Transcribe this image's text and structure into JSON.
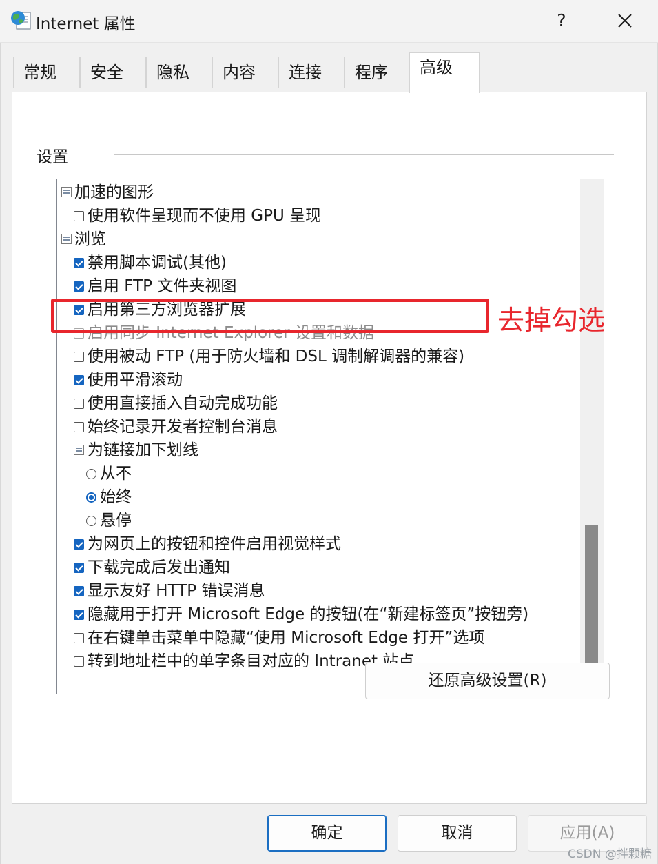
{
  "window": {
    "title": "Internet 属性",
    "help_glyph": "?",
    "close_glyph": "✕"
  },
  "tabs": [
    {
      "label": "常规",
      "active": false
    },
    {
      "label": "安全",
      "active": false
    },
    {
      "label": "隐私",
      "active": false
    },
    {
      "label": "内容",
      "active": false
    },
    {
      "label": "连接",
      "active": false
    },
    {
      "label": "程序",
      "active": false
    },
    {
      "label": "高级",
      "active": true
    }
  ],
  "settings": {
    "group_label": "设置",
    "items": [
      {
        "kind": "category",
        "label": "加速的图形"
      },
      {
        "kind": "checkbox",
        "label": "使用软件呈现而不使用 GPU 呈现",
        "checked": false
      },
      {
        "kind": "category",
        "label": "浏览"
      },
      {
        "kind": "checkbox",
        "label": "禁用脚本调试(其他)",
        "checked": true
      },
      {
        "kind": "checkbox",
        "label": "启用 FTP 文件夹视图",
        "checked": true
      },
      {
        "kind": "checkbox",
        "label": "启用第三方浏览器扩展",
        "checked": true
      },
      {
        "kind": "checkbox",
        "label": "启用同步 Internet Explorer 设置和数据",
        "checked": false,
        "disabled": true
      },
      {
        "kind": "checkbox",
        "label": "使用被动 FTP (用于防火墙和 DSL 调制解调器的兼容)",
        "checked": false
      },
      {
        "kind": "checkbox",
        "label": "使用平滑滚动",
        "checked": true
      },
      {
        "kind": "checkbox",
        "label": "使用直接插入自动完成功能",
        "checked": false
      },
      {
        "kind": "checkbox",
        "label": "始终记录开发者控制台消息",
        "checked": false
      },
      {
        "kind": "category",
        "label": "为链接加下划线"
      },
      {
        "kind": "radio",
        "label": "从不",
        "checked": false
      },
      {
        "kind": "radio",
        "label": "始终",
        "checked": true
      },
      {
        "kind": "radio",
        "label": "悬停",
        "checked": false
      },
      {
        "kind": "checkbox",
        "label": "为网页上的按钮和控件启用视觉样式",
        "checked": true
      },
      {
        "kind": "checkbox",
        "label": "下载完成后发出通知",
        "checked": true
      },
      {
        "kind": "checkbox",
        "label": "显示友好 HTTP 错误消息",
        "checked": true
      },
      {
        "kind": "checkbox",
        "label": "隐藏用于打开 Microsoft Edge 的按钮(在“新建标签页”按钮旁)",
        "checked": true
      },
      {
        "kind": "checkbox",
        "label": "在右键单击菜单中隐藏“使用 Microsoft Edge 打开”选项",
        "checked": false
      },
      {
        "kind": "checkbox",
        "label": "转到地址栏中的单字条目对应的 Intranet 站点",
        "checked": false
      }
    ]
  },
  "annotation": {
    "text": "去掉勾选",
    "color": "#e8262d"
  },
  "buttons": {
    "restore_advanced": "还原高级设置(R)",
    "ok": "确定",
    "cancel": "取消",
    "apply": "应用(A)"
  },
  "watermark": "CSDN @拌颗糖",
  "colors": {
    "accent": "#1565c0",
    "highlight": "#e8262d",
    "dialog_bg": "#f0f0f0"
  }
}
